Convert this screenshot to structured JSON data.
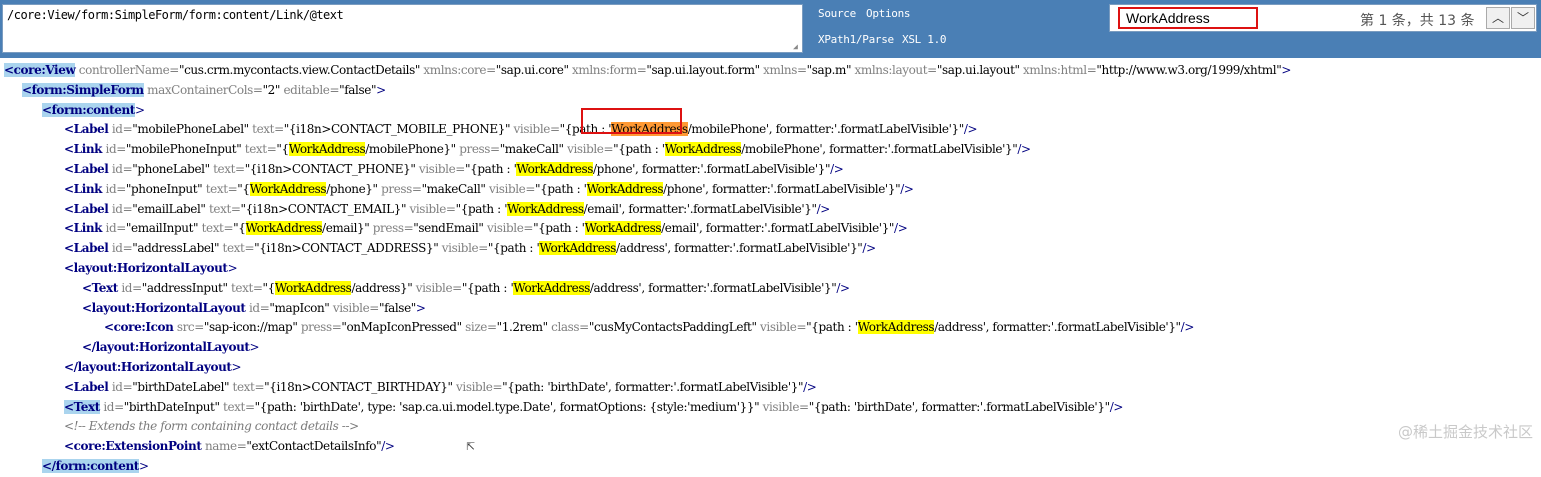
{
  "toolbar": {
    "xpath": "/core:View/form:SimpleForm/form:content/Link/@text",
    "source": "Source",
    "options": "Options",
    "xpath_parse": "XPath1/Parse",
    "xsl": "XSL 1.0"
  },
  "find": {
    "query": "WorkAddress",
    "count": "第 1 条，共 13 条",
    "prev_icon": "chevron-up",
    "next_icon": "chevron-down"
  },
  "code_lines": [
    {
      "indent": 0,
      "parts": [
        [
          "tsel",
          "<core:View"
        ],
        [
          "an",
          " controllerName="
        ],
        [
          "av",
          "\"cus.crm.mycontacts.view.ContactDetails\""
        ],
        [
          "an",
          " xmlns:core="
        ],
        [
          "av",
          "\"sap.ui.core\""
        ],
        [
          "an",
          " xmlns:form="
        ],
        [
          "av",
          "\"sap.ui.layout.form\""
        ],
        [
          "an",
          " xmlns="
        ],
        [
          "av",
          "\"sap.m\""
        ],
        [
          "an",
          " xmlns:layout="
        ],
        [
          "av",
          "\"sap.ui.layout\""
        ],
        [
          "an",
          " xmlns:html="
        ],
        [
          "av",
          "\"http://www.w3.org/1999/xhtml\""
        ],
        [
          "br",
          ">"
        ]
      ]
    },
    {
      "indent": 1,
      "parts": [
        [
          "tsel",
          "<form:SimpleForm"
        ],
        [
          "an",
          " maxContainerCols="
        ],
        [
          "av",
          "\"2\""
        ],
        [
          "an",
          " editable="
        ],
        [
          "av",
          "\"false\""
        ],
        [
          "br",
          ">"
        ]
      ]
    },
    {
      "indent": 2,
      "parts": [
        [
          "tsel",
          "<form:content"
        ],
        [
          "br",
          ">"
        ]
      ]
    },
    {
      "indent": 3,
      "parts": [
        [
          "t",
          "<Label"
        ],
        [
          "an",
          " id="
        ],
        [
          "av",
          "\"mobilePhoneLabel\""
        ],
        [
          "an",
          " text="
        ],
        [
          "av",
          "\"{i18n>CONTACT_MOBILE_PHONE}\""
        ],
        [
          "an",
          " visible="
        ],
        [
          "av",
          "\"{path : '"
        ],
        [
          "hlc",
          "WorkAddress"
        ],
        [
          "av",
          "/mobilePhone', formatter:'.formatLabelVisible'}\""
        ],
        [
          "br",
          "/>"
        ]
      ]
    },
    {
      "indent": 3,
      "parts": [
        [
          "t",
          "<Link"
        ],
        [
          "an",
          " id="
        ],
        [
          "av",
          "\"mobilePhoneInput\""
        ],
        [
          "an",
          " text="
        ],
        [
          "av",
          "\"{"
        ],
        [
          "hl",
          "WorkAddress"
        ],
        [
          "av",
          "/mobilePhone}\""
        ],
        [
          "an",
          " press="
        ],
        [
          "av",
          "\"makeCall\""
        ],
        [
          "an",
          " visible="
        ],
        [
          "av",
          "\"{path : '"
        ],
        [
          "hl",
          "WorkAddress"
        ],
        [
          "av",
          "/mobilePhone', formatter:'.formatLabelVisible'}\""
        ],
        [
          "br",
          "/>"
        ]
      ]
    },
    {
      "indent": 3,
      "parts": [
        [
          "t",
          "<Label"
        ],
        [
          "an",
          " id="
        ],
        [
          "av",
          "\"phoneLabel\""
        ],
        [
          "an",
          " text="
        ],
        [
          "av",
          "\"{i18n>CONTACT_PHONE}\""
        ],
        [
          "an",
          " visible="
        ],
        [
          "av",
          "\"{path : '"
        ],
        [
          "hl",
          "WorkAddress"
        ],
        [
          "av",
          "/phone', formatter:'.formatLabelVisible'}\""
        ],
        [
          "br",
          "/>"
        ]
      ]
    },
    {
      "indent": 3,
      "parts": [
        [
          "t",
          "<Link"
        ],
        [
          "an",
          " id="
        ],
        [
          "av",
          "\"phoneInput\""
        ],
        [
          "an",
          " text="
        ],
        [
          "av",
          "\"{"
        ],
        [
          "hl",
          "WorkAddress"
        ],
        [
          "av",
          "/phone}\""
        ],
        [
          "an",
          " press="
        ],
        [
          "av",
          "\"makeCall\""
        ],
        [
          "an",
          " visible="
        ],
        [
          "av",
          "\"{path : '"
        ],
        [
          "hl",
          "WorkAddress"
        ],
        [
          "av",
          "/phone', formatter:'.formatLabelVisible'}\""
        ],
        [
          "br",
          "/>"
        ]
      ]
    },
    {
      "indent": 3,
      "parts": [
        [
          "t",
          "<Label"
        ],
        [
          "an",
          " id="
        ],
        [
          "av",
          "\"emailLabel\""
        ],
        [
          "an",
          " text="
        ],
        [
          "av",
          "\"{i18n>CONTACT_EMAIL}\""
        ],
        [
          "an",
          " visible="
        ],
        [
          "av",
          "\"{path : '"
        ],
        [
          "hl",
          "WorkAddress"
        ],
        [
          "av",
          "/email', formatter:'.formatLabelVisible'}\""
        ],
        [
          "br",
          "/>"
        ]
      ]
    },
    {
      "indent": 3,
      "parts": [
        [
          "t",
          "<Link"
        ],
        [
          "an",
          " id="
        ],
        [
          "av",
          "\"emailInput\""
        ],
        [
          "an",
          " text="
        ],
        [
          "av",
          "\"{"
        ],
        [
          "hl",
          "WorkAddress"
        ],
        [
          "av",
          "/email}\""
        ],
        [
          "an",
          " press="
        ],
        [
          "av",
          "\"sendEmail\""
        ],
        [
          "an",
          " visible="
        ],
        [
          "av",
          "\"{path : '"
        ],
        [
          "hl",
          "WorkAddress"
        ],
        [
          "av",
          "/email', formatter:'.formatLabelVisible'}\""
        ],
        [
          "br",
          "/>"
        ]
      ]
    },
    {
      "indent": 3,
      "parts": [
        [
          "t",
          "<Label"
        ],
        [
          "an",
          " id="
        ],
        [
          "av",
          "\"addressLabel\""
        ],
        [
          "an",
          " text="
        ],
        [
          "av",
          "\"{i18n>CONTACT_ADDRESS}\""
        ],
        [
          "an",
          " visible="
        ],
        [
          "av",
          "\"{path : '"
        ],
        [
          "hl",
          "WorkAddress"
        ],
        [
          "av",
          "/address', formatter:'.formatLabelVisible'}\""
        ],
        [
          "br",
          "/>"
        ]
      ]
    },
    {
      "indent": 3,
      "parts": [
        [
          "t",
          "<layout:HorizontalLayout"
        ],
        [
          "br",
          ">"
        ]
      ]
    },
    {
      "indent": 4,
      "parts": [
        [
          "t",
          "<Text"
        ],
        [
          "an",
          " id="
        ],
        [
          "av",
          "\"addressInput\""
        ],
        [
          "an",
          " text="
        ],
        [
          "av",
          "\"{"
        ],
        [
          "hl",
          "WorkAddress"
        ],
        [
          "av",
          "/address}\""
        ],
        [
          "an",
          " visible="
        ],
        [
          "av",
          "\"{path : '"
        ],
        [
          "hl",
          "WorkAddress"
        ],
        [
          "av",
          "/address', formatter:'.formatLabelVisible'}\""
        ],
        [
          "br",
          "/>"
        ]
      ]
    },
    {
      "indent": 4,
      "parts": [
        [
          "t",
          "<layout:HorizontalLayout"
        ],
        [
          "an",
          " id="
        ],
        [
          "av",
          "\"mapIcon\""
        ],
        [
          "an",
          " visible="
        ],
        [
          "av",
          "\"false\""
        ],
        [
          "br",
          ">"
        ]
      ]
    },
    {
      "indent": 5,
      "parts": [
        [
          "t",
          "<core:Icon"
        ],
        [
          "an",
          " src="
        ],
        [
          "av",
          "\"sap-icon://map\""
        ],
        [
          "an",
          " press="
        ],
        [
          "av",
          "\"onMapIconPressed\""
        ],
        [
          "an",
          " size="
        ],
        [
          "av",
          "\"1.2rem\""
        ],
        [
          "an",
          " class="
        ],
        [
          "av",
          "\"cusMyContactsPaddingLeft\""
        ],
        [
          "an",
          " visible="
        ],
        [
          "av",
          "\"{path : '"
        ],
        [
          "hl",
          "WorkAddress"
        ],
        [
          "av",
          "/address', formatter:'.formatLabelVisible'}\""
        ],
        [
          "br",
          "/>"
        ]
      ]
    },
    {
      "indent": 4,
      "parts": [
        [
          "t",
          "</layout:HorizontalLayout"
        ],
        [
          "br",
          ">"
        ]
      ]
    },
    {
      "indent": 3,
      "parts": [
        [
          "t",
          "</layout:HorizontalLayout"
        ],
        [
          "br",
          ">"
        ]
      ]
    },
    {
      "indent": 3,
      "parts": [
        [
          "t",
          "<Label"
        ],
        [
          "an",
          " id="
        ],
        [
          "av",
          "\"birthDateLabel\""
        ],
        [
          "an",
          " text="
        ],
        [
          "av",
          "\"{i18n>CONTACT_BIRTHDAY}\""
        ],
        [
          "an",
          " visible="
        ],
        [
          "av",
          "\"{path: 'birthDate', formatter:'.formatLabelVisible'}\""
        ],
        [
          "br",
          "/>"
        ]
      ]
    },
    {
      "indent": 3,
      "parts": [
        [
          "tsel",
          "<Text"
        ],
        [
          "an",
          " id="
        ],
        [
          "av",
          "\"birthDateInput\""
        ],
        [
          "an",
          " text="
        ],
        [
          "av",
          "\"{path: 'birthDate', type: 'sap.ca.ui.model.type.Date', formatOptions: {style:'medium'}}\""
        ],
        [
          "an",
          " visible="
        ],
        [
          "av",
          "\"{path: 'birthDate', formatter:'.formatLabelVisible'}\""
        ],
        [
          "br",
          "/>"
        ]
      ]
    },
    {
      "indent": 3,
      "parts": [
        [
          "cm",
          "<!-- Extends the form containing contact details -->"
        ]
      ]
    },
    {
      "indent": 3,
      "parts": [
        [
          "t",
          "<core:ExtensionPoint"
        ],
        [
          "an",
          " name="
        ],
        [
          "av",
          "\"extContactDetailsInfo\""
        ],
        [
          "br",
          "/>"
        ]
      ]
    },
    {
      "indent": 2,
      "parts": [
        [
          "tsel",
          "</form:content"
        ],
        [
          "br",
          ">"
        ]
      ]
    }
  ],
  "watermark": "@稀土掘金技术社区"
}
